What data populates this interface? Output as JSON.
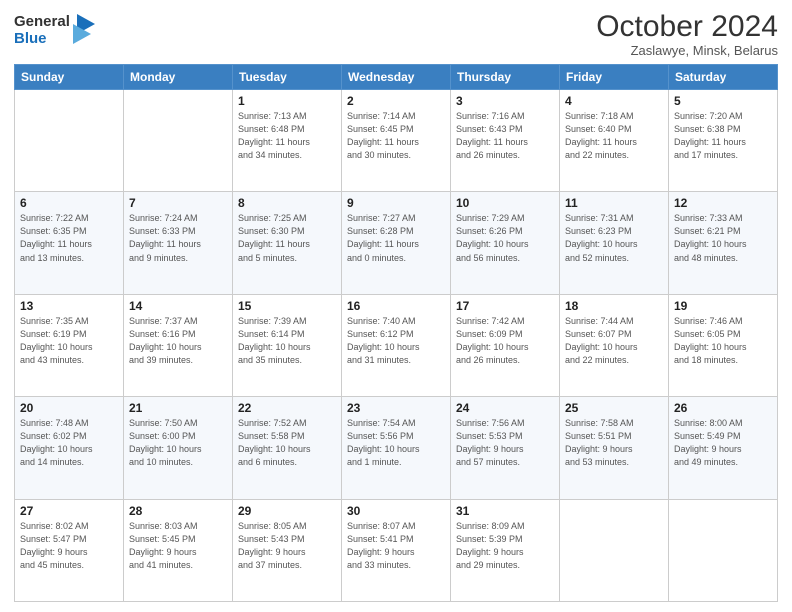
{
  "logo": {
    "general": "General",
    "blue": "Blue"
  },
  "header": {
    "month": "October 2024",
    "location": "Zaslawye, Minsk, Belarus"
  },
  "weekdays": [
    "Sunday",
    "Monday",
    "Tuesday",
    "Wednesday",
    "Thursday",
    "Friday",
    "Saturday"
  ],
  "weeks": [
    [
      {
        "day": "",
        "info": ""
      },
      {
        "day": "",
        "info": ""
      },
      {
        "day": "1",
        "info": "Sunrise: 7:13 AM\nSunset: 6:48 PM\nDaylight: 11 hours\nand 34 minutes."
      },
      {
        "day": "2",
        "info": "Sunrise: 7:14 AM\nSunset: 6:45 PM\nDaylight: 11 hours\nand 30 minutes."
      },
      {
        "day": "3",
        "info": "Sunrise: 7:16 AM\nSunset: 6:43 PM\nDaylight: 11 hours\nand 26 minutes."
      },
      {
        "day": "4",
        "info": "Sunrise: 7:18 AM\nSunset: 6:40 PM\nDaylight: 11 hours\nand 22 minutes."
      },
      {
        "day": "5",
        "info": "Sunrise: 7:20 AM\nSunset: 6:38 PM\nDaylight: 11 hours\nand 17 minutes."
      }
    ],
    [
      {
        "day": "6",
        "info": "Sunrise: 7:22 AM\nSunset: 6:35 PM\nDaylight: 11 hours\nand 13 minutes."
      },
      {
        "day": "7",
        "info": "Sunrise: 7:24 AM\nSunset: 6:33 PM\nDaylight: 11 hours\nand 9 minutes."
      },
      {
        "day": "8",
        "info": "Sunrise: 7:25 AM\nSunset: 6:30 PM\nDaylight: 11 hours\nand 5 minutes."
      },
      {
        "day": "9",
        "info": "Sunrise: 7:27 AM\nSunset: 6:28 PM\nDaylight: 11 hours\nand 0 minutes."
      },
      {
        "day": "10",
        "info": "Sunrise: 7:29 AM\nSunset: 6:26 PM\nDaylight: 10 hours\nand 56 minutes."
      },
      {
        "day": "11",
        "info": "Sunrise: 7:31 AM\nSunset: 6:23 PM\nDaylight: 10 hours\nand 52 minutes."
      },
      {
        "day": "12",
        "info": "Sunrise: 7:33 AM\nSunset: 6:21 PM\nDaylight: 10 hours\nand 48 minutes."
      }
    ],
    [
      {
        "day": "13",
        "info": "Sunrise: 7:35 AM\nSunset: 6:19 PM\nDaylight: 10 hours\nand 43 minutes."
      },
      {
        "day": "14",
        "info": "Sunrise: 7:37 AM\nSunset: 6:16 PM\nDaylight: 10 hours\nand 39 minutes."
      },
      {
        "day": "15",
        "info": "Sunrise: 7:39 AM\nSunset: 6:14 PM\nDaylight: 10 hours\nand 35 minutes."
      },
      {
        "day": "16",
        "info": "Sunrise: 7:40 AM\nSunset: 6:12 PM\nDaylight: 10 hours\nand 31 minutes."
      },
      {
        "day": "17",
        "info": "Sunrise: 7:42 AM\nSunset: 6:09 PM\nDaylight: 10 hours\nand 26 minutes."
      },
      {
        "day": "18",
        "info": "Sunrise: 7:44 AM\nSunset: 6:07 PM\nDaylight: 10 hours\nand 22 minutes."
      },
      {
        "day": "19",
        "info": "Sunrise: 7:46 AM\nSunset: 6:05 PM\nDaylight: 10 hours\nand 18 minutes."
      }
    ],
    [
      {
        "day": "20",
        "info": "Sunrise: 7:48 AM\nSunset: 6:02 PM\nDaylight: 10 hours\nand 14 minutes."
      },
      {
        "day": "21",
        "info": "Sunrise: 7:50 AM\nSunset: 6:00 PM\nDaylight: 10 hours\nand 10 minutes."
      },
      {
        "day": "22",
        "info": "Sunrise: 7:52 AM\nSunset: 5:58 PM\nDaylight: 10 hours\nand 6 minutes."
      },
      {
        "day": "23",
        "info": "Sunrise: 7:54 AM\nSunset: 5:56 PM\nDaylight: 10 hours\nand 1 minute."
      },
      {
        "day": "24",
        "info": "Sunrise: 7:56 AM\nSunset: 5:53 PM\nDaylight: 9 hours\nand 57 minutes."
      },
      {
        "day": "25",
        "info": "Sunrise: 7:58 AM\nSunset: 5:51 PM\nDaylight: 9 hours\nand 53 minutes."
      },
      {
        "day": "26",
        "info": "Sunrise: 8:00 AM\nSunset: 5:49 PM\nDaylight: 9 hours\nand 49 minutes."
      }
    ],
    [
      {
        "day": "27",
        "info": "Sunrise: 8:02 AM\nSunset: 5:47 PM\nDaylight: 9 hours\nand 45 minutes."
      },
      {
        "day": "28",
        "info": "Sunrise: 8:03 AM\nSunset: 5:45 PM\nDaylight: 9 hours\nand 41 minutes."
      },
      {
        "day": "29",
        "info": "Sunrise: 8:05 AM\nSunset: 5:43 PM\nDaylight: 9 hours\nand 37 minutes."
      },
      {
        "day": "30",
        "info": "Sunrise: 8:07 AM\nSunset: 5:41 PM\nDaylight: 9 hours\nand 33 minutes."
      },
      {
        "day": "31",
        "info": "Sunrise: 8:09 AM\nSunset: 5:39 PM\nDaylight: 9 hours\nand 29 minutes."
      },
      {
        "day": "",
        "info": ""
      },
      {
        "day": "",
        "info": ""
      }
    ]
  ]
}
